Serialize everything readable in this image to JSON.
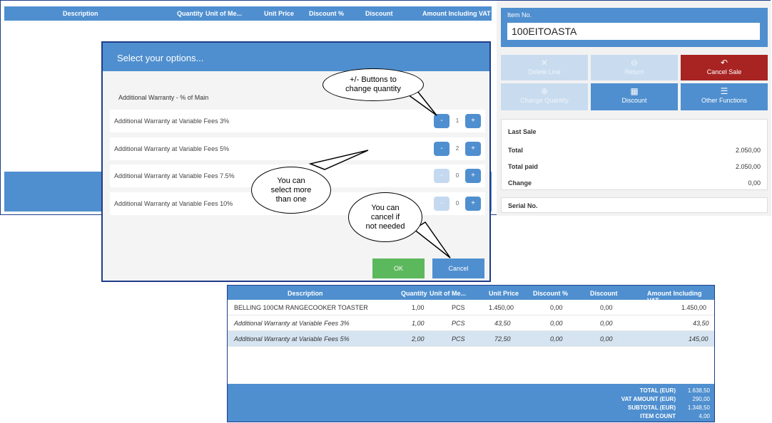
{
  "pos": {
    "lines_header": {
      "description": "Description",
      "quantity": "Quantity",
      "unit": "Unit of Me...",
      "unit_price": "Unit Price",
      "discount_pct": "Discount %",
      "discount": "Discount",
      "amount": "Amount Including VAT"
    },
    "item_no_label": "Item No.",
    "item_no_value": "100EITOASTA",
    "buttons": {
      "delete_line": "Delete Line",
      "return": "Return",
      "cancel_sale": "Cancel Sale",
      "change_quantity": "Change Quantity",
      "discount": "Discount",
      "other_functions": "Other Functions"
    },
    "last_sale": {
      "title": "Last Sale",
      "total_label": "Total",
      "total_value": "2.050,00",
      "total_paid_label": "Total paid",
      "total_paid_value": "2.050,00",
      "change_label": "Change",
      "change_value": "0,00"
    },
    "serial_label": "Serial No."
  },
  "modal": {
    "title": "Select your options...",
    "group_label": "Additional Warranty - % of Main",
    "options": [
      {
        "label": "Additional Warranty at Variable Fees 3%",
        "qty": "1"
      },
      {
        "label": "Additional Warranty at Variable Fees 5%",
        "qty": "2"
      },
      {
        "label": "Additional Warranty at Variable Fees 7.5%",
        "qty": "0"
      },
      {
        "label": "Additional Warranty at Variable Fees 10%",
        "qty": "0"
      }
    ],
    "minus": "-",
    "plus": "+",
    "ok": "OK",
    "cancel": "Cancel"
  },
  "callouts": {
    "buttons": "+/- Buttons to change quantity",
    "multi": "You can select more than one",
    "cancel": "You can cancel if not needed"
  },
  "result": {
    "header": {
      "description": "Description",
      "quantity": "Quantity",
      "unit": "Unit of Me...",
      "unit_price": "Unit Price",
      "discount_pct": "Discount %",
      "discount": "Discount",
      "amount": "Amount Including VAT"
    },
    "rows": [
      {
        "description": "BELLING 100CM RANGECOOKER TOASTER",
        "quantity": "1,00",
        "unit": "PCS",
        "unit_price": "1.450,00",
        "discount_pct": "0,00",
        "discount": "0,00",
        "amount": "1.450,00"
      },
      {
        "description": "Additional Warranty at Variable Fees 3%",
        "quantity": "1,00",
        "unit": "PCS",
        "unit_price": "43,50",
        "discount_pct": "0,00",
        "discount": "0,00",
        "amount": "43,50"
      },
      {
        "description": "Additional Warranty at Variable Fees 5%",
        "quantity": "2,00",
        "unit": "PCS",
        "unit_price": "72,50",
        "discount_pct": "0,00",
        "discount": "0,00",
        "amount": "145,00"
      }
    ],
    "totals": [
      {
        "label": "TOTAL (EUR)",
        "value": "1.638,50"
      },
      {
        "label": "VAT AMOUNT (EUR)",
        "value": "290,00"
      },
      {
        "label": "SUBTOTAL (EUR)",
        "value": "1.348,50"
      },
      {
        "label": "ITEM COUNT",
        "value": "4,00"
      }
    ]
  },
  "colors": {
    "accent": "#4f8fcf",
    "danger": "#a82422",
    "ok": "#5cb85c",
    "frame": "#1f3d8a"
  }
}
